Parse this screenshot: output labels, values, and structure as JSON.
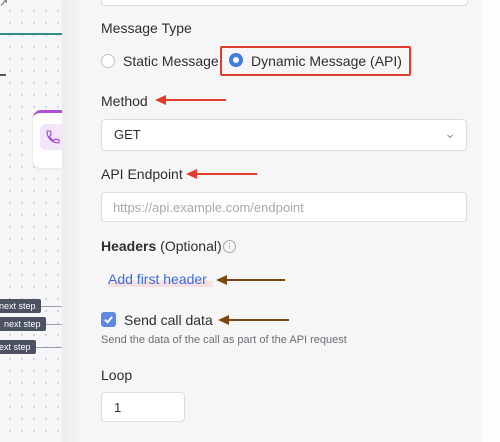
{
  "canvas": {
    "step_pills": [
      "next step",
      "next step",
      "ext step"
    ]
  },
  "form": {
    "message_type": {
      "label": "Message Type",
      "options": [
        "Static Message",
        "Dynamic Message (API)"
      ],
      "selected": "Dynamic Message (API)"
    },
    "method": {
      "label": "Method",
      "value": "GET"
    },
    "api_endpoint": {
      "label": "API Endpoint",
      "placeholder": "https://api.example.com/endpoint"
    },
    "headers": {
      "label_bold": "Headers",
      "label_suffix": "(Optional)",
      "add_link": "Add first header"
    },
    "send_call_data": {
      "label": "Send call data",
      "checked": true,
      "description": "Send the data of the call as part of the API request"
    },
    "loop": {
      "label": "Loop",
      "value": "1"
    }
  },
  "colors": {
    "accent": "#3f7fe0",
    "link": "#3b6fd8",
    "annotation_red": "#e23c2e",
    "annotation_brown": "#7a4a12",
    "node_purple": "#b04fd4"
  }
}
